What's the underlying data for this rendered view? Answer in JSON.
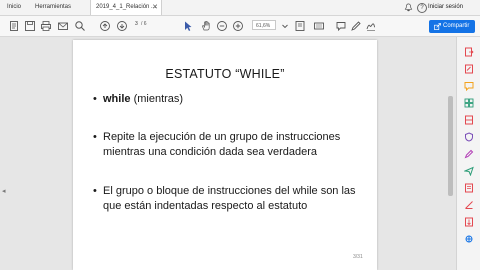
{
  "tabs": {
    "home": "Inicio",
    "tools": "Herramientas",
    "document": "2019_4_1_Relación ..."
  },
  "account": {
    "signin_label": "Iniciar sesión"
  },
  "toolbar": {
    "page_current": "3",
    "page_total": "/ 6",
    "zoom": "61,6%",
    "share_label": "Compartir",
    "share_color": "#1473e6"
  },
  "slide": {
    "title": "ESTATUTO “WHILE”",
    "bullets": [
      {
        "bold": "while",
        "text": " (mientras)"
      },
      {
        "bold": "",
        "text": "Repite la ejecución de un grupo de instrucciones mientras una condición dada sea verdadera"
      },
      {
        "bold": "",
        "text": "El grupo o bloque de instrucciones del while son las que están indentadas respecto al estatuto"
      }
    ],
    "bullet_symbol": "•",
    "page_number": "3/31"
  },
  "right_panel": {
    "icons": [
      "export-pdf-icon",
      "edit-pdf-icon",
      "comment-icon",
      "organize-pages-icon",
      "scan-icon",
      "protect-icon",
      "fill-sign-icon",
      "send-icon",
      "more-tools-icon",
      "redact-icon",
      "compress-icon",
      "print-production-icon"
    ],
    "accent_colors": [
      "#e34850",
      "#e34850",
      "#f3a21c",
      "#2d9d78",
      "#e34850",
      "#7b4fb8",
      "#b13bb5",
      "#2d9d78",
      "#e34850",
      "#e34850",
      "#e34850",
      "#1473e6"
    ]
  }
}
